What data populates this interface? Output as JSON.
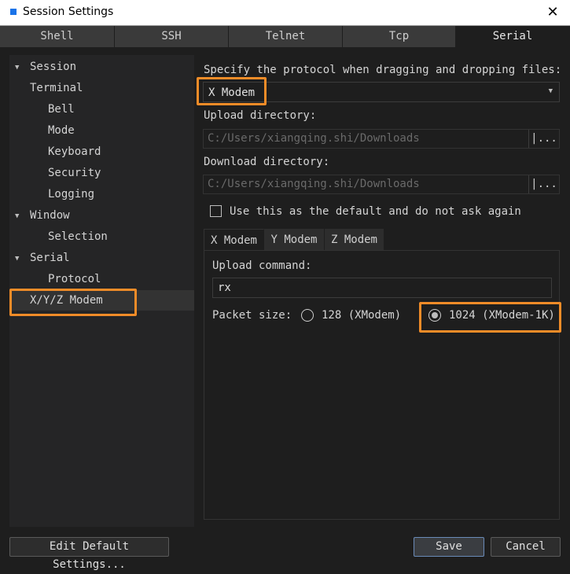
{
  "window": {
    "title": "Session Settings",
    "close_glyph": "✕"
  },
  "tabs": [
    {
      "label": "Shell"
    },
    {
      "label": "SSH"
    },
    {
      "label": "Telnet"
    },
    {
      "label": "Tcp"
    },
    {
      "label": "Serial"
    }
  ],
  "active_tab": "Serial",
  "tree": {
    "session": "Session",
    "terminal": "Terminal",
    "bell": "Bell",
    "mode": "Mode",
    "keyboard": "Keyboard",
    "security": "Security",
    "logging": "Logging",
    "window": "Window",
    "selection": "Selection",
    "serial": "Serial",
    "protocol": "Protocol",
    "xyz_modem": "X/Y/Z Modem"
  },
  "protocol": {
    "label": "Specify the protocol when dragging and dropping files:",
    "value": "X Modem"
  },
  "upload_dir": {
    "label": "Upload directory:",
    "value": "C:/Users/xiangqing.shi/Downloads",
    "browse": "|..."
  },
  "download_dir": {
    "label": "Download directory:",
    "value": "C:/Users/xiangqing.shi/Downloads",
    "browse": "|..."
  },
  "default_checkbox": {
    "label": "Use this as the default and do not ask again",
    "checked": false
  },
  "modem_tabs": [
    {
      "label": "X Modem"
    },
    {
      "label": "Y Modem"
    },
    {
      "label": "Z Modem"
    }
  ],
  "upload_command": {
    "label": "Upload command:",
    "value": "rx"
  },
  "packet_size": {
    "label": "Packet size:",
    "options": [
      {
        "label": "128 (XModem)",
        "checked": false
      },
      {
        "label": "1024 (XModem-1K)",
        "checked": true
      }
    ]
  },
  "footer": {
    "edit_default": "Edit Default Settings...",
    "save": "Save",
    "cancel": "Cancel"
  },
  "colors": {
    "highlight": "#f28c28",
    "background": "#1e1e1e",
    "tab_inactive": "#3a3a3a"
  }
}
